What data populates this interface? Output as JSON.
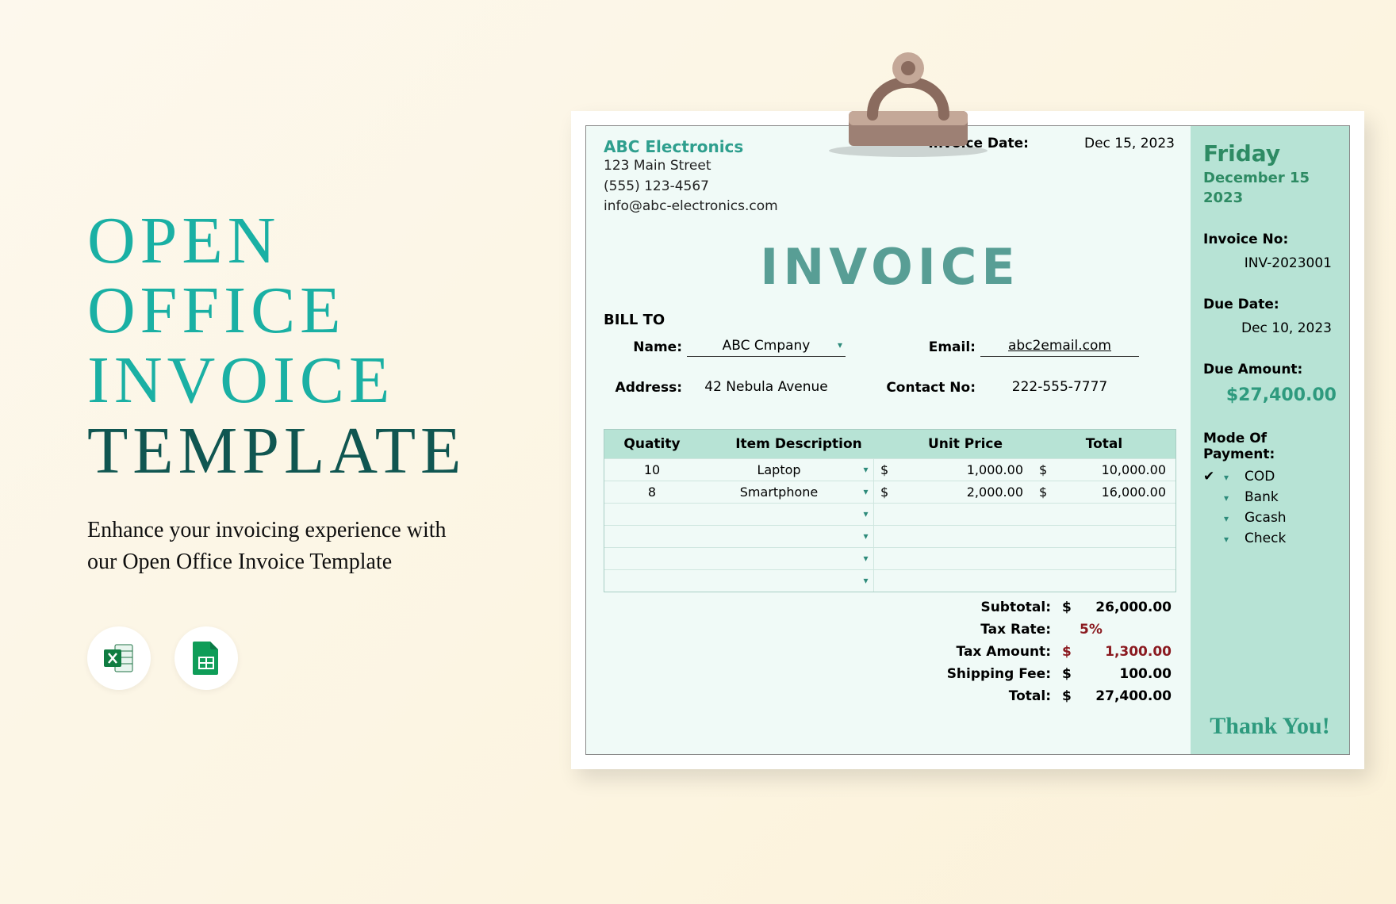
{
  "left": {
    "title_lines": [
      "OPEN",
      "OFFICE",
      "INVOICE",
      "TEMPLATE"
    ],
    "subtitle": "Enhance your invoicing experience with our Open Office Invoice Template",
    "icons": [
      "excel-icon",
      "google-sheets-icon"
    ]
  },
  "invoice": {
    "company": {
      "name": "ABC Electronics",
      "street": "123 Main Street",
      "phone": "(555) 123-4567",
      "email": "info@abc-electronics.com"
    },
    "invoice_date_label": "Invoice Date:",
    "invoice_date": "Dec 15, 2023",
    "heading": "INVOICE",
    "bill_to_label": "BILL TO",
    "bill_to": {
      "name_label": "Name:",
      "name": "ABC Cmpany",
      "email_label": "Email:",
      "email": "abc2email.com",
      "address_label": "Address:",
      "address": "42 Nebula Avenue",
      "contact_label": "Contact No:",
      "contact": "222-555-7777"
    },
    "columns": {
      "qty": "Quatity",
      "desc": "Item Description",
      "unit": "Unit Price",
      "total": "Total"
    },
    "rows": [
      {
        "qty": "10",
        "desc": "Laptop",
        "unit": "1,000.00",
        "total": "10,000.00"
      },
      {
        "qty": "8",
        "desc": "Smartphone",
        "unit": "2,000.00",
        "total": "16,000.00"
      },
      {
        "qty": "",
        "desc": "",
        "unit": "",
        "total": ""
      },
      {
        "qty": "",
        "desc": "",
        "unit": "",
        "total": ""
      },
      {
        "qty": "",
        "desc": "",
        "unit": "",
        "total": ""
      },
      {
        "qty": "",
        "desc": "",
        "unit": "",
        "total": ""
      }
    ],
    "totals": {
      "subtotal_label": "Subtotal:",
      "subtotal": "26,000.00",
      "tax_rate_label": "Tax Rate:",
      "tax_rate": "5%",
      "tax_amount_label": "Tax Amount:",
      "tax_amount": "1,300.00",
      "shipping_label": "Shipping Fee:",
      "shipping": "100.00",
      "total_label": "Total:",
      "total": "27,400.00",
      "currency": "$"
    },
    "side": {
      "day": "Friday",
      "date": "December 15",
      "year": "2023",
      "invoice_no_label": "Invoice No:",
      "invoice_no": "INV-2023001",
      "due_date_label": "Due Date:",
      "due_date": "Dec 10, 2023",
      "due_amount_label": "Due Amount:",
      "due_amount": "$27,400.00",
      "mode_label": "Mode Of Payment:",
      "options": [
        {
          "checked": true,
          "label": "COD"
        },
        {
          "checked": false,
          "label": "Bank"
        },
        {
          "checked": false,
          "label": "Gcash"
        },
        {
          "checked": false,
          "label": "Check"
        }
      ],
      "thank_you": "Thank You!"
    }
  }
}
